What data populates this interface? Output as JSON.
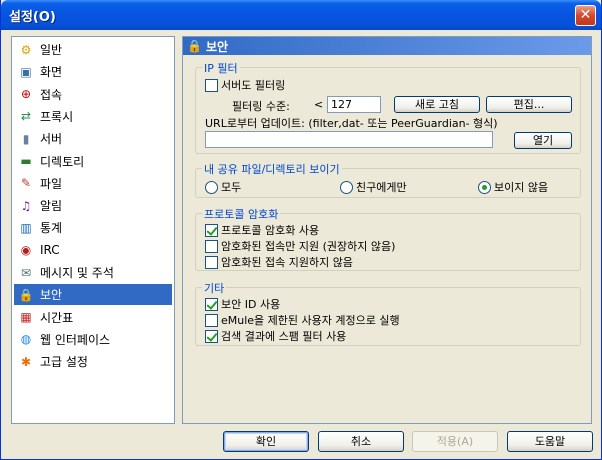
{
  "window": {
    "title": "설정(O)",
    "close_label": "✕"
  },
  "nav": {
    "items": [
      {
        "label": "일반",
        "icon": "gear-icon",
        "glyph": "⚙",
        "color": "#e0a000"
      },
      {
        "label": "화면",
        "icon": "monitor-icon",
        "glyph": "▣",
        "color": "#3a6ea5"
      },
      {
        "label": "접속",
        "icon": "connection-icon",
        "glyph": "⊕",
        "color": "#c00000"
      },
      {
        "label": "프록시",
        "icon": "proxy-icon",
        "glyph": "⇄",
        "color": "#2e8b57"
      },
      {
        "label": "서버",
        "icon": "server-icon",
        "glyph": "▮",
        "color": "#6b7fa0"
      },
      {
        "label": "디렉토리",
        "icon": "folder-icon",
        "glyph": "▬",
        "color": "#2e7d32"
      },
      {
        "label": "파일",
        "icon": "file-icon",
        "glyph": "✎",
        "color": "#c0392b"
      },
      {
        "label": "알림",
        "icon": "notification-icon",
        "glyph": "♫",
        "color": "#7b1fa2"
      },
      {
        "label": "통계",
        "icon": "statistics-icon",
        "glyph": "▥",
        "color": "#1565c0"
      },
      {
        "label": "IRC",
        "icon": "irc-icon",
        "glyph": "◉",
        "color": "#b71c1c"
      },
      {
        "label": "메시지 및 주석",
        "icon": "message-icon",
        "glyph": "✉",
        "color": "#546e7a"
      },
      {
        "label": "보안",
        "icon": "lock-icon",
        "glyph": "🔒",
        "color": "#e6a700"
      },
      {
        "label": "시간표",
        "icon": "calendar-icon",
        "glyph": "▦",
        "color": "#c62828"
      },
      {
        "label": "웹 인터페이스",
        "icon": "web-icon",
        "glyph": "◍",
        "color": "#1e88e5"
      },
      {
        "label": "고급 설정",
        "icon": "advanced-icon",
        "glyph": "✱",
        "color": "#ef6c00"
      }
    ],
    "selected_index": 11
  },
  "content": {
    "header": "보안",
    "ip_filter": {
      "legend": "IP 필터",
      "server_filter_label": "서버도 필터링",
      "server_filter_checked": false,
      "level_label": "필터링 수준:",
      "level_op": "<",
      "level_value": "127",
      "reload_button": "새로 고침",
      "edit_button": "편집...",
      "url_update_label": "URL로부터 업데이트: (filter,dat- 또는 PeerGuardian- 형식)",
      "url_value": "",
      "open_button": "열기"
    },
    "share_visibility": {
      "legend": "내 공유 파일/디렉토리 보이기",
      "options": [
        "모두",
        "친구에게만",
        "보이지 않음"
      ],
      "selected_index": 2
    },
    "obfuscation": {
      "legend": "프로토콜 암호화",
      "options": [
        {
          "label": "프로토콜 암호화 사용",
          "checked": true
        },
        {
          "label": "암호화된 접속만 지원 (권장하지 않음)",
          "checked": false
        },
        {
          "label": "암호화된 접속 지원하지 않음",
          "checked": false
        }
      ]
    },
    "misc": {
      "legend": "기타",
      "options": [
        {
          "label": "보안 ID 사용",
          "checked": true
        },
        {
          "label": "eMule을 제한된 사용자 계정으로 실행",
          "checked": false
        },
        {
          "label": "검색 결과에 스팸 필터 사용",
          "checked": true
        }
      ]
    }
  },
  "footer": {
    "ok": "확인",
    "cancel": "취소",
    "apply": "적용(A)",
    "help": "도움말"
  }
}
